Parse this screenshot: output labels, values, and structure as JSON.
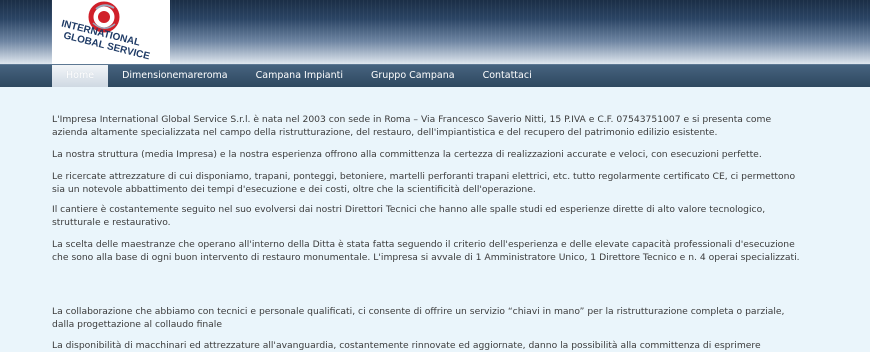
{
  "logo": {
    "line1": "INTERNATIONAL",
    "line2": "GLOBAL SERVICE",
    "colors": {
      "ring": "#d0202a",
      "text": "#1f3b66"
    }
  },
  "nav": {
    "items": [
      {
        "label": "Home",
        "active": true
      },
      {
        "label": "Dimensionemareroma",
        "active": false
      },
      {
        "label": "Campana Impianti",
        "active": false
      },
      {
        "label": "Gruppo Campana",
        "active": false
      },
      {
        "label": "Contattaci",
        "active": false
      }
    ]
  },
  "content": {
    "paragraphs": [
      "L'Impresa International Global Service S.r.l. è nata nel 2003 con sede in Roma – Via Francesco Saverio Nitti, 15 P.IVA e C.F. 07543751007 e si presenta come azienda altamente specializzata nel campo della ristrutturazione, del restauro, dell'impiantistica e del recupero del patrimonio edilizio esistente.",
      "La nostra struttura (media Impresa) e la nostra esperienza offrono alla committenza la certezza di realizzazioni accurate e veloci, con esecuzioni perfette.",
      "Le ricercate attrezzature di cui disponiamo, trapani, ponteggi, betoniere, martelli perforanti trapani elettrici, etc. tutto regolarmente certificato CE, ci permettono sia un notevole abbattimento dei tempi d'esecuzione e dei costi, oltre che la scientificità dell'operazione.",
      "Il cantiere è costantemente seguito nel suo evolversi dai nostri Direttori Tecnici che hanno alle spalle studi ed esperienze dirette di alto valore tecnologico, strutturale e restaurativo.",
      "La scelta delle maestranze che operano all'interno della Ditta è stata fatta seguendo il criterio dell'esperienza e delle elevate capacità professionali d'esecuzione che sono alla base di ogni buon intervento di restauro monumentale. L'impresa si avvale di 1 Amministratore Unico, 1 Direttore Tecnico e n. 4 operai specializzati.",
      "La collaborazione che abbiamo con tecnici e personale qualificati, ci consente di offrire un servizio “chiavi in mano” per la ristrutturazione completa o parziale, dalla progettazione al collaudo finale",
      "La disponibilità di macchinari ed attrezzature all'avanguardia, costantemente rinnovate ed aggiornate, danno la possibilità alla committenza di esprimere"
    ]
  }
}
